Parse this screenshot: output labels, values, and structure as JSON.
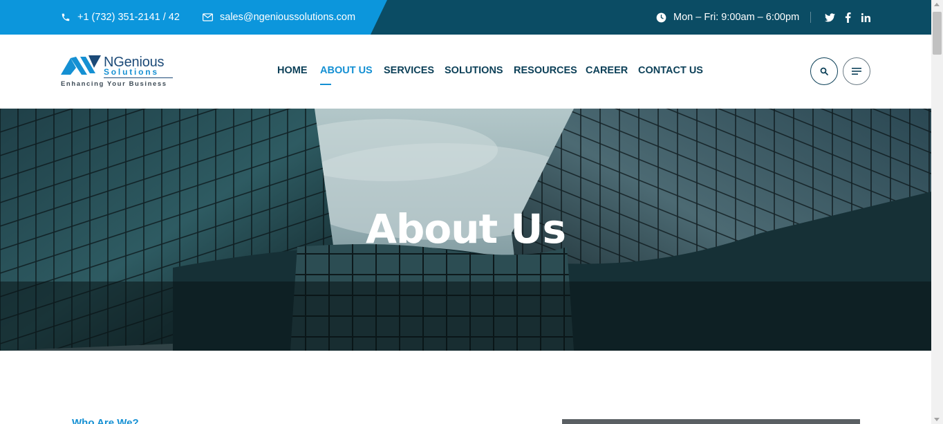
{
  "topbar": {
    "phone": "+1 (732) 351-2141 / 42",
    "email": "sales@ngenioussolutions.com",
    "hours": "Mon – Fri: 9:00am – 6:00pm",
    "social": [
      "twitter-icon",
      "facebook-icon",
      "linkedin-icon"
    ],
    "colors": {
      "bar": "#0b4c64",
      "accent": "#0c96dc"
    }
  },
  "logo": {
    "name": "NGenious",
    "sub": "Solutions",
    "tagline": "Enhancing Your Business"
  },
  "nav": {
    "items": [
      {
        "label": "HOME",
        "active": false
      },
      {
        "label": "ABOUT US",
        "active": true
      },
      {
        "label": "SERVICES",
        "active": false
      },
      {
        "label": "SOLUTIONS",
        "active": false
      },
      {
        "label": "RESOURCES",
        "active": false
      },
      {
        "label": "CAREER",
        "active": false
      },
      {
        "label": "CONTACT US",
        "active": false
      }
    ],
    "active_color": "#1590d3",
    "text_color": "#0b3f57"
  },
  "hero": {
    "title": "About Us"
  },
  "content": {
    "heading": "Who Are We?"
  }
}
